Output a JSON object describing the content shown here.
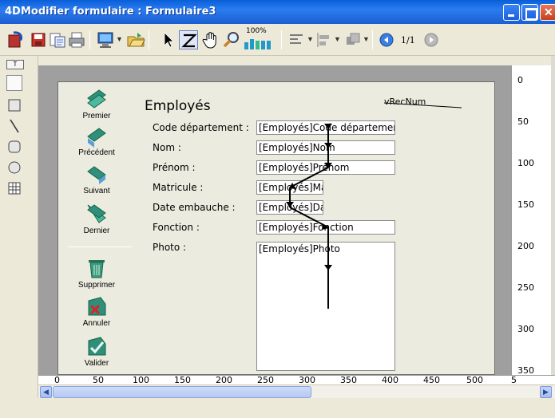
{
  "window": {
    "title": "Modifier formulaire : Formulaire3",
    "logo": "4D"
  },
  "toolbar": {
    "zoom": "100%",
    "page": "1/1"
  },
  "form": {
    "title": "Employés",
    "record_var": "vRecNum",
    "nav_buttons": [
      {
        "label": "Premier",
        "icon": "first-record-icon"
      },
      {
        "label": "Précédent",
        "icon": "previous-record-icon"
      },
      {
        "label": "Suivant",
        "icon": "next-record-icon"
      },
      {
        "label": "Dernier",
        "icon": "last-record-icon"
      }
    ],
    "action_buttons": [
      {
        "label": "Supprimer",
        "icon": "delete-icon"
      },
      {
        "label": "Annuler",
        "icon": "cancel-icon"
      },
      {
        "label": "Valider",
        "icon": "validate-icon"
      }
    ],
    "fields": [
      {
        "label": "Code département :",
        "value": "[Employés]Code départemer"
      },
      {
        "label": "Nom :",
        "value": "[Employés]Nom"
      },
      {
        "label": "Prénom :",
        "value": "[Employés]Prénom"
      },
      {
        "label": "Matricule :",
        "value": "[Employés]Ma"
      },
      {
        "label": "Date embauche :",
        "value": "[Employés]Da"
      },
      {
        "label": "Fonction :",
        "value": "[Employés]Fonction"
      },
      {
        "label": "Photo :",
        "value": "[Employés]Photo"
      }
    ]
  },
  "rulers": {
    "horizontal": [
      "0",
      "50",
      "100",
      "150",
      "200",
      "250",
      "300",
      "350",
      "400",
      "450",
      "500",
      "5"
    ],
    "vertical": [
      "0",
      "50",
      "100",
      "150",
      "200",
      "250",
      "300",
      "350"
    ]
  }
}
